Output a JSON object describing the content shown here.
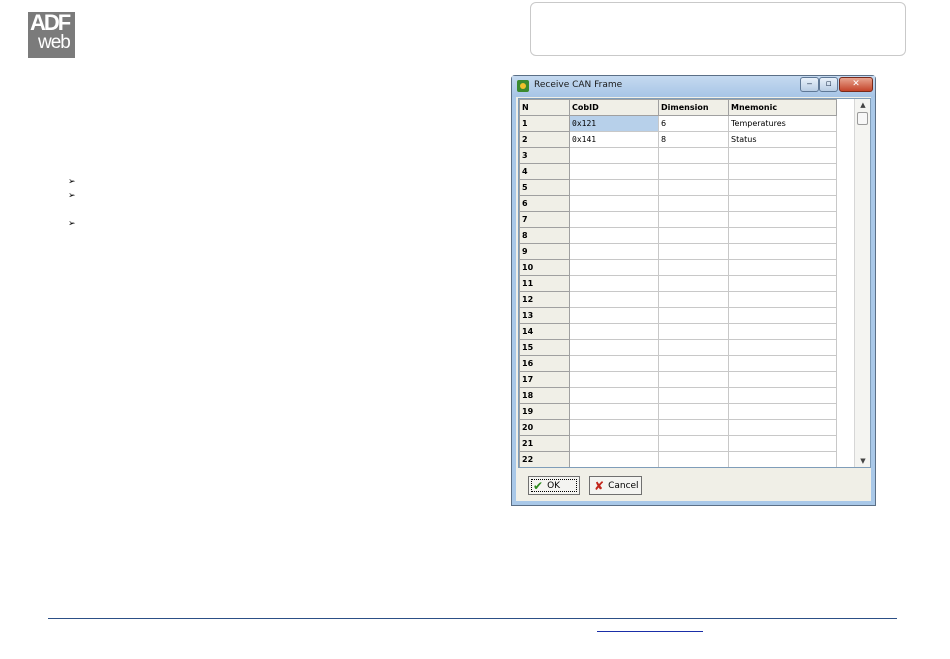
{
  "logo": {
    "line1": "ADF",
    "line2": "web"
  },
  "bullets": [
    "➢",
    "➢",
    "➢"
  ],
  "dialog": {
    "title": "Receive CAN Frame",
    "window_buttons": {
      "minimize": "‒",
      "maximize": "▫",
      "close": "✕"
    },
    "columns": [
      "N",
      "CobID",
      "Dimension",
      "Mnemonic"
    ],
    "rows": [
      {
        "n": "1",
        "cobid": "0x121",
        "dimension": "6",
        "mnemonic": "Temperatures"
      },
      {
        "n": "2",
        "cobid": "0x141",
        "dimension": "8",
        "mnemonic": "Status"
      },
      {
        "n": "3",
        "cobid": "",
        "dimension": "",
        "mnemonic": ""
      },
      {
        "n": "4",
        "cobid": "",
        "dimension": "",
        "mnemonic": ""
      },
      {
        "n": "5",
        "cobid": "",
        "dimension": "",
        "mnemonic": ""
      },
      {
        "n": "6",
        "cobid": "",
        "dimension": "",
        "mnemonic": ""
      },
      {
        "n": "7",
        "cobid": "",
        "dimension": "",
        "mnemonic": ""
      },
      {
        "n": "8",
        "cobid": "",
        "dimension": "",
        "mnemonic": ""
      },
      {
        "n": "9",
        "cobid": "",
        "dimension": "",
        "mnemonic": ""
      },
      {
        "n": "10",
        "cobid": "",
        "dimension": "",
        "mnemonic": ""
      },
      {
        "n": "11",
        "cobid": "",
        "dimension": "",
        "mnemonic": ""
      },
      {
        "n": "12",
        "cobid": "",
        "dimension": "",
        "mnemonic": ""
      },
      {
        "n": "13",
        "cobid": "",
        "dimension": "",
        "mnemonic": ""
      },
      {
        "n": "14",
        "cobid": "",
        "dimension": "",
        "mnemonic": ""
      },
      {
        "n": "15",
        "cobid": "",
        "dimension": "",
        "mnemonic": ""
      },
      {
        "n": "16",
        "cobid": "",
        "dimension": "",
        "mnemonic": ""
      },
      {
        "n": "17",
        "cobid": "",
        "dimension": "",
        "mnemonic": ""
      },
      {
        "n": "18",
        "cobid": "",
        "dimension": "",
        "mnemonic": ""
      },
      {
        "n": "19",
        "cobid": "",
        "dimension": "",
        "mnemonic": ""
      },
      {
        "n": "20",
        "cobid": "",
        "dimension": "",
        "mnemonic": ""
      },
      {
        "n": "21",
        "cobid": "",
        "dimension": "",
        "mnemonic": ""
      },
      {
        "n": "22",
        "cobid": "",
        "dimension": "",
        "mnemonic": ""
      }
    ],
    "scroll": {
      "up": "▲",
      "down": "▼"
    },
    "ok_label": "OK",
    "cancel_label": "Cancel",
    "ok_icon": "✔",
    "cancel_icon": "✘"
  },
  "colors": {
    "title_bar": "#a7c5e6",
    "selected_cell": "#b7d0ea",
    "footer_line": "#2c4f86"
  }
}
